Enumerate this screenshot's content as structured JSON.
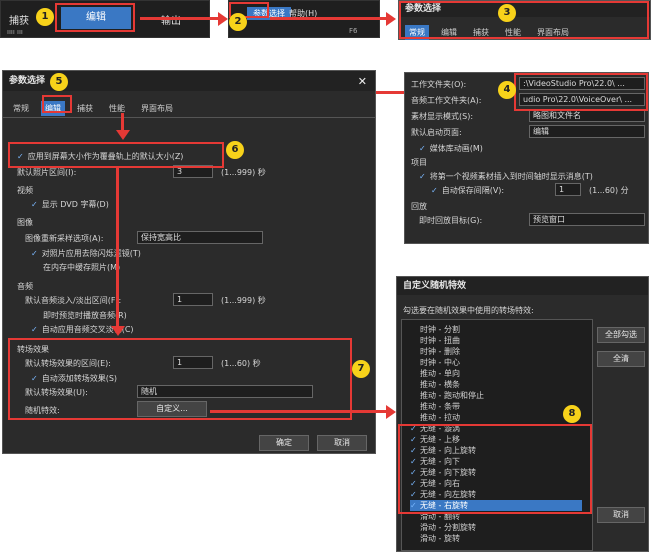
{
  "menubar_top": {
    "capture": "捕获",
    "edit": "编辑",
    "output": "输出",
    "progress": "ıııı ııı"
  },
  "menubar_second": {
    "params": "参数选择",
    "help": "帮助(H)",
    "extra": "F6"
  },
  "prefs_small": {
    "title": "参数选择",
    "tabs": [
      "常规",
      "编辑",
      "捕获",
      "性能",
      "界面布局"
    ]
  },
  "general_tab": {
    "rows": [
      {
        "label": "工作文件夹(O):",
        "value": ":\\VideoStudio Pro\\22.0\\ ..."
      },
      {
        "label": "音频工作文件夹(A):",
        "value": "udio Pro\\22.0\\VoiceOver\\ ..."
      },
      {
        "label": "素材显示模式(S):",
        "value": "略图和文件名"
      },
      {
        "label": "默认启动页面:",
        "value": "编辑"
      }
    ],
    "media_library_anim": "媒体库动画(M)",
    "project_label": "项目",
    "project_first_video": "将第一个视频素材插入到时间轴时显示消息(T)",
    "auto_save": "自动保存间隔(V):",
    "auto_save_value": "1",
    "auto_save_range": "(1...60) 分",
    "playback_label": "回放",
    "instant_playback": "即时回放目标(G):",
    "instant_playback_value": "预览窗口"
  },
  "edit_dialog": {
    "title": "参数选择",
    "close": "✕",
    "tabs": [
      "常规",
      "编辑",
      "捕获",
      "性能",
      "界面布局"
    ],
    "apply_color_filter": "应用到屏幕大小作为覆叠轨上的默认大小(Z)",
    "default_photo_duration": "默认照片区间(I):",
    "default_photo_value": "3",
    "default_photo_range": "(1...999) 秒",
    "video_label": "视频",
    "show_dvd": "显示 DVD 字幕(D)",
    "image_label": "图像",
    "image_resample": "图像重新采样选项(A):",
    "image_resample_value": "保持宽高比",
    "photo_flicker": "对照片应用去除闪烁滤镜(T)",
    "cache_photos": "在内存中缓存照片(M)",
    "audio_label": "音频",
    "audio_fade": "默认音频淡入/淡出区间(F):",
    "audio_fade_value": "1",
    "audio_fade_range": "(1...999) 秒",
    "instant_audio": "即时预览时播放音频(R)",
    "auto_audio_fade": "自动应用音频交叉淡化(C)",
    "transition_label": "转场效果",
    "default_transition_duration": "默认转场效果的区间(E):",
    "default_transition_value": "1",
    "default_transition_range": "(1...60) 秒",
    "auto_add_transition": "自动添加转场效果(S)",
    "default_transition_effect": "默认转场效果(U):",
    "default_transition_effect_value": "随机",
    "random_effect": "随机特效:",
    "custom_button": "自定义...",
    "ok": "确定",
    "cancel": "取消"
  },
  "custom_dialog": {
    "title": "自定义随机特效",
    "subtitle": "勾选要在随机效果中使用的转场特效:",
    "select_all": "全部勾选",
    "clear_all": "全清",
    "cancel": "取消",
    "items": [
      {
        "label": "时钟 - 分割",
        "checked": false
      },
      {
        "label": "时钟 - 扭曲",
        "checked": false
      },
      {
        "label": "时钟 - 删除",
        "checked": false
      },
      {
        "label": "时钟 - 中心",
        "checked": false
      },
      {
        "label": "推动 - 单向",
        "checked": false
      },
      {
        "label": "推动 - 横条",
        "checked": false
      },
      {
        "label": "推动 - 跑动和停止",
        "checked": false
      },
      {
        "label": "推动 - 条带",
        "checked": false
      },
      {
        "label": "推动 - 拉动",
        "checked": false
      },
      {
        "label": "无缝 - 漩涡",
        "checked": true
      },
      {
        "label": "无缝 - 上移",
        "checked": true
      },
      {
        "label": "无缝 - 向上旋转",
        "checked": true
      },
      {
        "label": "无缝 - 向下",
        "checked": true
      },
      {
        "label": "无缝 - 向下旋转",
        "checked": true
      },
      {
        "label": "无缝 - 向右",
        "checked": true
      },
      {
        "label": "无缝 - 向左旋转",
        "checked": true
      },
      {
        "label": "无缝 - 右旋转",
        "checked": true
      },
      {
        "label": "滑动 - 翻转",
        "checked": false
      },
      {
        "label": "滑动 - 分割旋转",
        "checked": false
      },
      {
        "label": "滑动 - 旋转",
        "checked": false
      }
    ]
  },
  "badges": [
    "1",
    "2",
    "3",
    "4",
    "5",
    "6",
    "7",
    "8"
  ],
  "colors": {
    "accent": "#3a78c4",
    "highlight": "#e53935",
    "badge": "#f7d21a",
    "panel": "#2b2b2b"
  }
}
